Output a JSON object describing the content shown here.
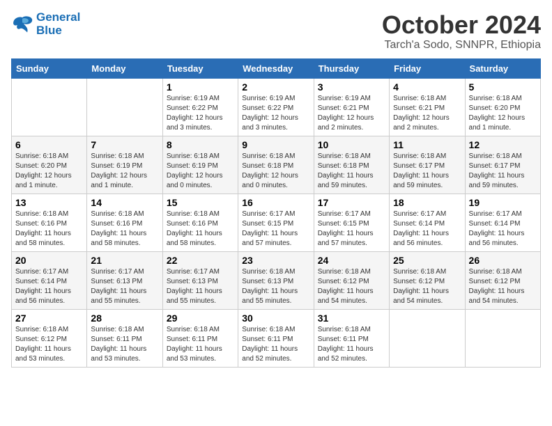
{
  "header": {
    "logo_line1": "General",
    "logo_line2": "Blue",
    "month_title": "October 2024",
    "subtitle": "Tarch'a Sodo, SNNPR, Ethiopia"
  },
  "weekdays": [
    "Sunday",
    "Monday",
    "Tuesday",
    "Wednesday",
    "Thursday",
    "Friday",
    "Saturday"
  ],
  "weeks": [
    [
      {
        "day": "",
        "detail": ""
      },
      {
        "day": "",
        "detail": ""
      },
      {
        "day": "1",
        "detail": "Sunrise: 6:19 AM\nSunset: 6:22 PM\nDaylight: 12 hours and 3 minutes."
      },
      {
        "day": "2",
        "detail": "Sunrise: 6:19 AM\nSunset: 6:22 PM\nDaylight: 12 hours and 3 minutes."
      },
      {
        "day": "3",
        "detail": "Sunrise: 6:19 AM\nSunset: 6:21 PM\nDaylight: 12 hours and 2 minutes."
      },
      {
        "day": "4",
        "detail": "Sunrise: 6:18 AM\nSunset: 6:21 PM\nDaylight: 12 hours and 2 minutes."
      },
      {
        "day": "5",
        "detail": "Sunrise: 6:18 AM\nSunset: 6:20 PM\nDaylight: 12 hours and 1 minute."
      }
    ],
    [
      {
        "day": "6",
        "detail": "Sunrise: 6:18 AM\nSunset: 6:20 PM\nDaylight: 12 hours and 1 minute."
      },
      {
        "day": "7",
        "detail": "Sunrise: 6:18 AM\nSunset: 6:19 PM\nDaylight: 12 hours and 1 minute."
      },
      {
        "day": "8",
        "detail": "Sunrise: 6:18 AM\nSunset: 6:19 PM\nDaylight: 12 hours and 0 minutes."
      },
      {
        "day": "9",
        "detail": "Sunrise: 6:18 AM\nSunset: 6:18 PM\nDaylight: 12 hours and 0 minutes."
      },
      {
        "day": "10",
        "detail": "Sunrise: 6:18 AM\nSunset: 6:18 PM\nDaylight: 11 hours and 59 minutes."
      },
      {
        "day": "11",
        "detail": "Sunrise: 6:18 AM\nSunset: 6:17 PM\nDaylight: 11 hours and 59 minutes."
      },
      {
        "day": "12",
        "detail": "Sunrise: 6:18 AM\nSunset: 6:17 PM\nDaylight: 11 hours and 59 minutes."
      }
    ],
    [
      {
        "day": "13",
        "detail": "Sunrise: 6:18 AM\nSunset: 6:16 PM\nDaylight: 11 hours and 58 minutes."
      },
      {
        "day": "14",
        "detail": "Sunrise: 6:18 AM\nSunset: 6:16 PM\nDaylight: 11 hours and 58 minutes."
      },
      {
        "day": "15",
        "detail": "Sunrise: 6:18 AM\nSunset: 6:16 PM\nDaylight: 11 hours and 58 minutes."
      },
      {
        "day": "16",
        "detail": "Sunrise: 6:17 AM\nSunset: 6:15 PM\nDaylight: 11 hours and 57 minutes."
      },
      {
        "day": "17",
        "detail": "Sunrise: 6:17 AM\nSunset: 6:15 PM\nDaylight: 11 hours and 57 minutes."
      },
      {
        "day": "18",
        "detail": "Sunrise: 6:17 AM\nSunset: 6:14 PM\nDaylight: 11 hours and 56 minutes."
      },
      {
        "day": "19",
        "detail": "Sunrise: 6:17 AM\nSunset: 6:14 PM\nDaylight: 11 hours and 56 minutes."
      }
    ],
    [
      {
        "day": "20",
        "detail": "Sunrise: 6:17 AM\nSunset: 6:14 PM\nDaylight: 11 hours and 56 minutes."
      },
      {
        "day": "21",
        "detail": "Sunrise: 6:17 AM\nSunset: 6:13 PM\nDaylight: 11 hours and 55 minutes."
      },
      {
        "day": "22",
        "detail": "Sunrise: 6:17 AM\nSunset: 6:13 PM\nDaylight: 11 hours and 55 minutes."
      },
      {
        "day": "23",
        "detail": "Sunrise: 6:18 AM\nSunset: 6:13 PM\nDaylight: 11 hours and 55 minutes."
      },
      {
        "day": "24",
        "detail": "Sunrise: 6:18 AM\nSunset: 6:12 PM\nDaylight: 11 hours and 54 minutes."
      },
      {
        "day": "25",
        "detail": "Sunrise: 6:18 AM\nSunset: 6:12 PM\nDaylight: 11 hours and 54 minutes."
      },
      {
        "day": "26",
        "detail": "Sunrise: 6:18 AM\nSunset: 6:12 PM\nDaylight: 11 hours and 54 minutes."
      }
    ],
    [
      {
        "day": "27",
        "detail": "Sunrise: 6:18 AM\nSunset: 6:12 PM\nDaylight: 11 hours and 53 minutes."
      },
      {
        "day": "28",
        "detail": "Sunrise: 6:18 AM\nSunset: 6:11 PM\nDaylight: 11 hours and 53 minutes."
      },
      {
        "day": "29",
        "detail": "Sunrise: 6:18 AM\nSunset: 6:11 PM\nDaylight: 11 hours and 53 minutes."
      },
      {
        "day": "30",
        "detail": "Sunrise: 6:18 AM\nSunset: 6:11 PM\nDaylight: 11 hours and 52 minutes."
      },
      {
        "day": "31",
        "detail": "Sunrise: 6:18 AM\nSunset: 6:11 PM\nDaylight: 11 hours and 52 minutes."
      },
      {
        "day": "",
        "detail": ""
      },
      {
        "day": "",
        "detail": ""
      }
    ]
  ]
}
